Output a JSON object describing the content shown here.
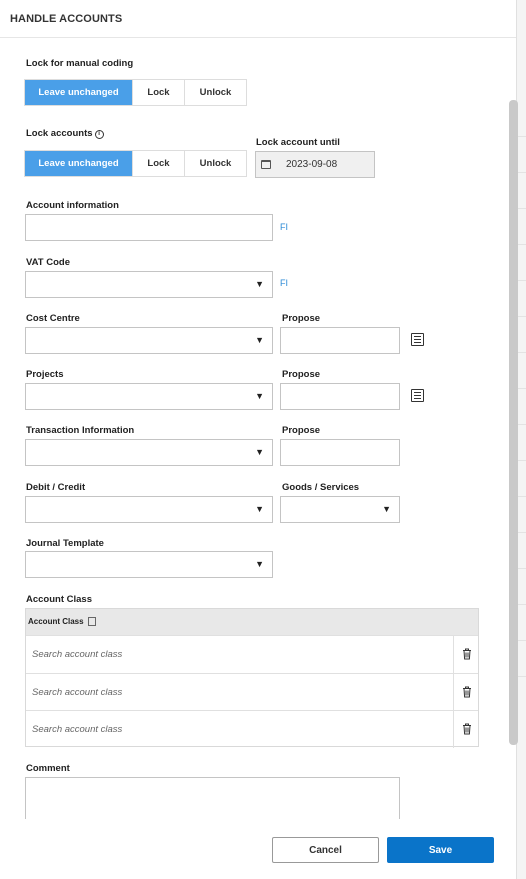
{
  "dialog": {
    "title": "HANDLE ACCOUNTS"
  },
  "lock_manual": {
    "label": "Lock for manual coding",
    "options": [
      "Leave unchanged",
      "Lock",
      "Unlock"
    ],
    "selected": "Leave unchanged"
  },
  "lock_accounts": {
    "label": "Lock accounts",
    "info_glyph": "i",
    "options": [
      "Leave unchanged",
      "Lock",
      "Unlock"
    ],
    "selected": "Leave unchanged"
  },
  "lock_until": {
    "label": "Lock account until",
    "value": "2023-09-08",
    "icon": "calendar-icon"
  },
  "account_information": {
    "label": "Account information",
    "value": "",
    "link": "FI"
  },
  "vat_code": {
    "label": "VAT Code",
    "value": "",
    "link": "FI"
  },
  "cost_centre": {
    "label": "Cost Centre",
    "value": "",
    "propose_label": "Propose",
    "propose_value": "",
    "icon": "list-icon"
  },
  "projects": {
    "label": "Projects",
    "value": "",
    "propose_label": "Propose",
    "propose_value": "",
    "icon": "list-icon"
  },
  "transaction_information": {
    "label": "Transaction Information",
    "value": "",
    "propose_label": "Propose",
    "propose_value": ""
  },
  "debit_credit": {
    "label": "Debit / Credit",
    "value": ""
  },
  "goods_services": {
    "label": "Goods / Services",
    "value": ""
  },
  "journal_template": {
    "label": "Journal Template",
    "value": ""
  },
  "account_class": {
    "label": "Account Class",
    "column_header": "Account Class",
    "rows": [
      {
        "placeholder": "Search account class"
      },
      {
        "placeholder": "Search account class"
      },
      {
        "placeholder": "Search account class"
      }
    ]
  },
  "comment": {
    "label": "Comment",
    "value": ""
  },
  "footer": {
    "cancel_label": "Cancel",
    "save_label": "Save"
  },
  "colors": {
    "accent": "#4a9fe8",
    "primary_button": "#0a74c9",
    "link": "#2a8ad6"
  }
}
